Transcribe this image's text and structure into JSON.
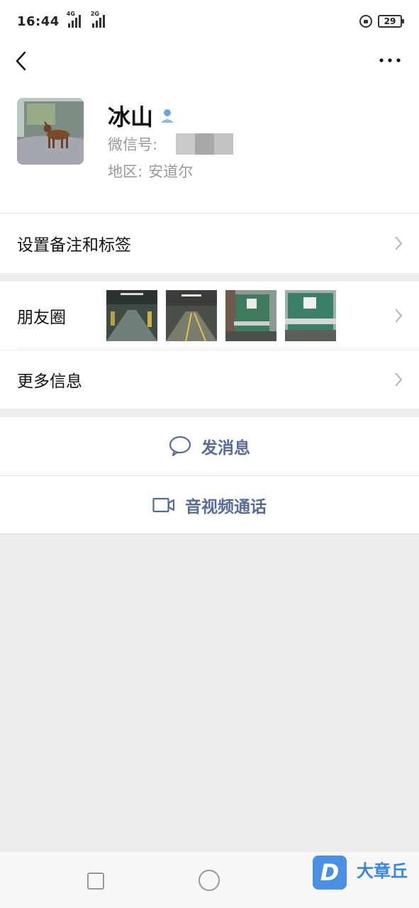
{
  "status_bar": {
    "time": "16:44",
    "signal1_tag": "4G",
    "signal2_tag": "2G",
    "battery": "29"
  },
  "nav": {
    "back_icon": "chevron-left-icon",
    "more_icon": "ellipsis-icon"
  },
  "profile": {
    "name": "冰山",
    "wechat_id_label": "微信号:",
    "region_label": "地区:",
    "region_value": "安道尔"
  },
  "rows": {
    "remark_label": "设置备注和标签",
    "moments_label": "朋友圈",
    "more_info_label": "更多信息"
  },
  "actions": {
    "message_label": "发消息",
    "call_label": "音视频通话"
  },
  "watermark": {
    "logo_letter": "D",
    "text": "大章丘"
  },
  "colors": {
    "link": "#576b95",
    "background": "#ededed"
  }
}
